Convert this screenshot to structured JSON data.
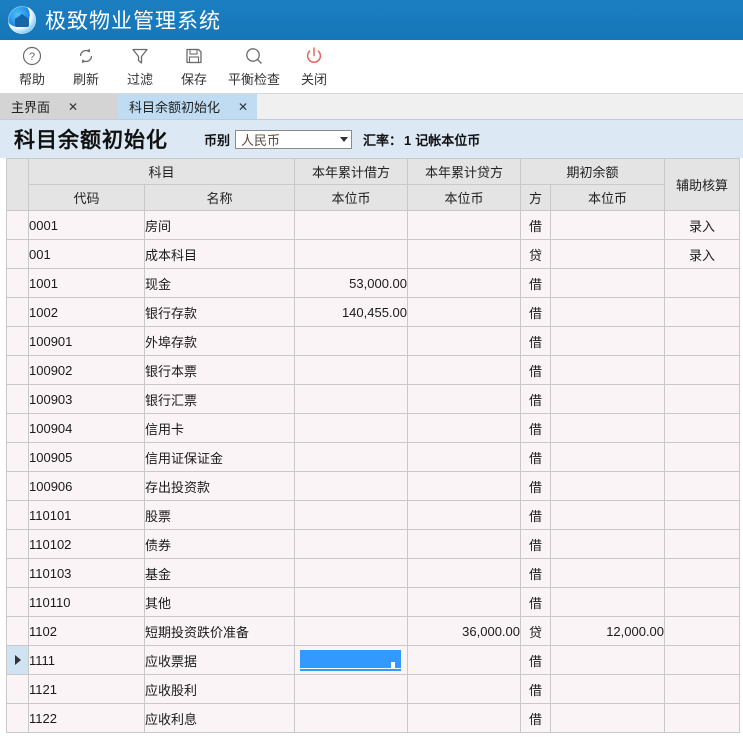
{
  "window": {
    "app_title": "极致物业管理系统",
    "logo_icon": "house-swirl-logo-icon",
    "accent_color": "#1676b8"
  },
  "toolbar": {
    "items": [
      {
        "label": "帮助",
        "icon": "help-circle-icon"
      },
      {
        "label": "刷新",
        "icon": "refresh-icon"
      },
      {
        "label": "过滤",
        "icon": "filter-funnel-icon"
      },
      {
        "label": "保存",
        "icon": "save-floppy-icon"
      },
      {
        "label": "平衡检查",
        "icon": "search-magnifier-icon"
      },
      {
        "label": "关闭",
        "icon": "power-off-icon"
      }
    ],
    "close_icon_color": "#e8625f"
  },
  "tabs": [
    {
      "label": "主界面",
      "active": false,
      "close_label": "✕"
    },
    {
      "label": "科目余额初始化",
      "active": true,
      "close_label": "✕"
    }
  ],
  "page_header": {
    "title": "科目余额初始化",
    "currency_label": "币别",
    "currency_value": "人民币",
    "currency_options": [
      "人民币"
    ],
    "rate_label": "汇率：",
    "rate_value": "1",
    "rate_suffix": "记帐本位币"
  },
  "grid": {
    "header": {
      "group_subject": "科目",
      "group_year_debit": "本年累计借方",
      "group_year_credit": "本年累计贷方",
      "group_opening": "期初余额",
      "group_aux": "辅助核算",
      "sub_code": "代码",
      "sub_name": "名称",
      "sub_currency_debit": "本位币",
      "sub_currency_credit": "本位币",
      "sub_direction": "方",
      "sub_currency_balance": "本位币"
    },
    "rows": [
      {
        "code": "0001",
        "name": "房间",
        "year_debit": "",
        "year_credit": "",
        "direction": "借",
        "opening": "",
        "aux": "录入",
        "selected": false,
        "editing": false
      },
      {
        "code": "001",
        "name": "成本科目",
        "year_debit": "",
        "year_credit": "",
        "direction": "贷",
        "opening": "",
        "aux": "录入",
        "selected": false,
        "editing": false
      },
      {
        "code": "1001",
        "name": "现金",
        "year_debit": "53,000.00",
        "year_credit": "",
        "direction": "借",
        "opening": "",
        "aux": "",
        "selected": false,
        "editing": false
      },
      {
        "code": "1002",
        "name": "银行存款",
        "year_debit": "140,455.00",
        "year_credit": "",
        "direction": "借",
        "opening": "",
        "aux": "",
        "selected": false,
        "editing": false
      },
      {
        "code": "100901",
        "name": "外埠存款",
        "year_debit": "",
        "year_credit": "",
        "direction": "借",
        "opening": "",
        "aux": "",
        "selected": false,
        "editing": false
      },
      {
        "code": "100902",
        "name": "银行本票",
        "year_debit": "",
        "year_credit": "",
        "direction": "借",
        "opening": "",
        "aux": "",
        "selected": false,
        "editing": false
      },
      {
        "code": "100903",
        "name": "银行汇票",
        "year_debit": "",
        "year_credit": "",
        "direction": "借",
        "opening": "",
        "aux": "",
        "selected": false,
        "editing": false
      },
      {
        "code": "100904",
        "name": "信用卡",
        "year_debit": "",
        "year_credit": "",
        "direction": "借",
        "opening": "",
        "aux": "",
        "selected": false,
        "editing": false
      },
      {
        "code": "100905",
        "name": "信用证保证金",
        "year_debit": "",
        "year_credit": "",
        "direction": "借",
        "opening": "",
        "aux": "",
        "selected": false,
        "editing": false
      },
      {
        "code": "100906",
        "name": "存出投资款",
        "year_debit": "",
        "year_credit": "",
        "direction": "借",
        "opening": "",
        "aux": "",
        "selected": false,
        "editing": false
      },
      {
        "code": "110101",
        "name": "股票",
        "year_debit": "",
        "year_credit": "",
        "direction": "借",
        "opening": "",
        "aux": "",
        "selected": false,
        "editing": false
      },
      {
        "code": "110102",
        "name": "债券",
        "year_debit": "",
        "year_credit": "",
        "direction": "借",
        "opening": "",
        "aux": "",
        "selected": false,
        "editing": false
      },
      {
        "code": "110103",
        "name": "基金",
        "year_debit": "",
        "year_credit": "",
        "direction": "借",
        "opening": "",
        "aux": "",
        "selected": false,
        "editing": false
      },
      {
        "code": "110110",
        "name": "其他",
        "year_debit": "",
        "year_credit": "",
        "direction": "借",
        "opening": "",
        "aux": "",
        "selected": false,
        "editing": false
      },
      {
        "code": "1102",
        "name": "短期投资跌价准备",
        "year_debit": "",
        "year_credit": "36,000.00",
        "direction": "贷",
        "opening": "12,000.00",
        "aux": "",
        "selected": false,
        "editing": false
      },
      {
        "code": "1111",
        "name": "应收票据",
        "year_debit": "",
        "year_credit": "",
        "direction": "借",
        "opening": "",
        "aux": "",
        "selected": true,
        "editing": true
      },
      {
        "code": "1121",
        "name": "应收股利",
        "year_debit": "",
        "year_credit": "",
        "direction": "借",
        "opening": "",
        "aux": "",
        "selected": false,
        "editing": false
      },
      {
        "code": "1122",
        "name": "应收利息",
        "year_debit": "",
        "year_credit": "",
        "direction": "借",
        "opening": "",
        "aux": "",
        "selected": false,
        "editing": false
      }
    ],
    "selection_color": "#3399ff"
  }
}
